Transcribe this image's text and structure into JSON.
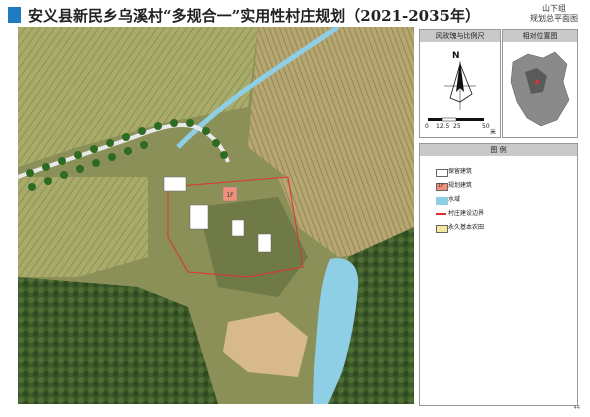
{
  "header": {
    "title": "安义县新民乡乌溪村“多规合一”实用性村庄规划（2021-2035年）",
    "sheet_line1": "山下组",
    "sheet_line2": "规划总平面图"
  },
  "panels": {
    "rose_title": "风玫瑰与比例尺",
    "north_label": "N",
    "scale_ticks": [
      "0",
      "12.5",
      "25",
      "50"
    ],
    "scale_unit": "米",
    "location_title": "相对位置图",
    "legend_title": "图 例"
  },
  "legend": [
    {
      "label": "保留建筑",
      "color": "#ffffff"
    },
    {
      "label": "规划建筑",
      "color": "#f0907c",
      "mark": "1F"
    },
    {
      "label": "水域",
      "color": "#8ecfe6"
    },
    {
      "label": "村庄建设边界",
      "color": "#e03030"
    },
    {
      "label": "永久基本农田",
      "color": "#f3eaa0"
    }
  ],
  "map": {
    "building_mark": "1F"
  },
  "footer": {
    "page_number": "44"
  }
}
